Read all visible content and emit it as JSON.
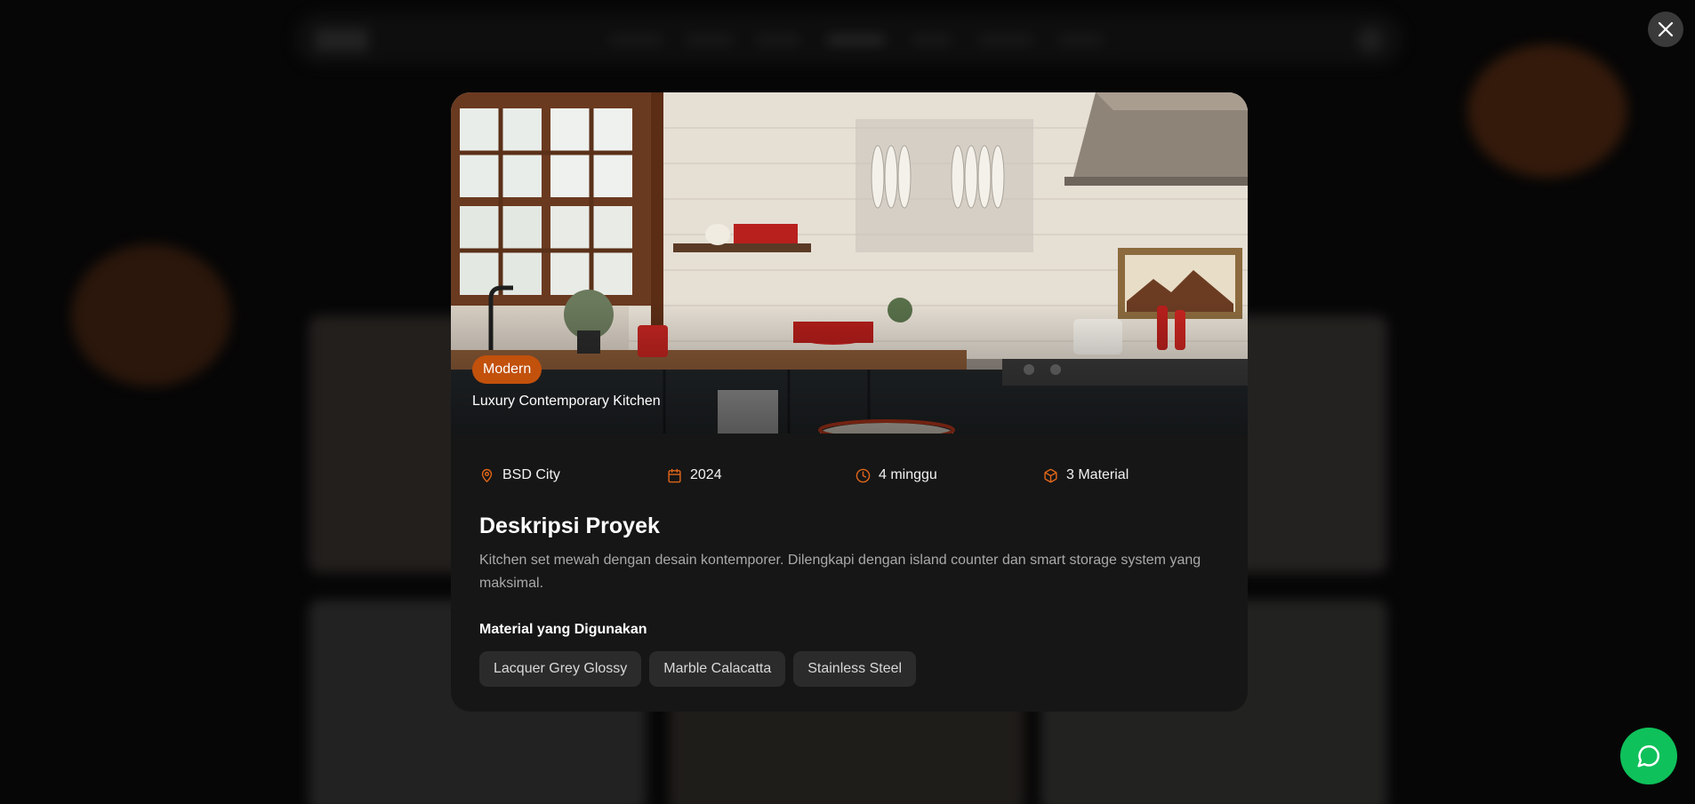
{
  "modal": {
    "badge": "Modern",
    "title": "Luxury Contemporary Kitchen",
    "meta": {
      "location": "BSD City",
      "year": "2024",
      "duration": "4 minggu",
      "materials_count": "3 Material"
    },
    "section_title": "Deskripsi Proyek",
    "description": "Kitchen set mewah dengan desain kontemporer. Dilengkapi dengan island counter dan smart storage system yang maksimal.",
    "materials_title": "Material yang Digunakan",
    "materials": [
      "Lacquer Grey Glossy",
      "Marble Calacatta",
      "Stainless Steel"
    ]
  },
  "icons": {
    "close": "close-icon",
    "location": "map-pin-icon",
    "year": "calendar-icon",
    "duration": "clock-icon",
    "materials": "package-icon",
    "chat": "whatsapp-icon"
  },
  "colors": {
    "accent": "#c2510c",
    "icon_accent": "#e0661a",
    "whatsapp": "#0fc15b",
    "modal_bg": "#161616",
    "chip_bg": "#2b2b2b"
  }
}
